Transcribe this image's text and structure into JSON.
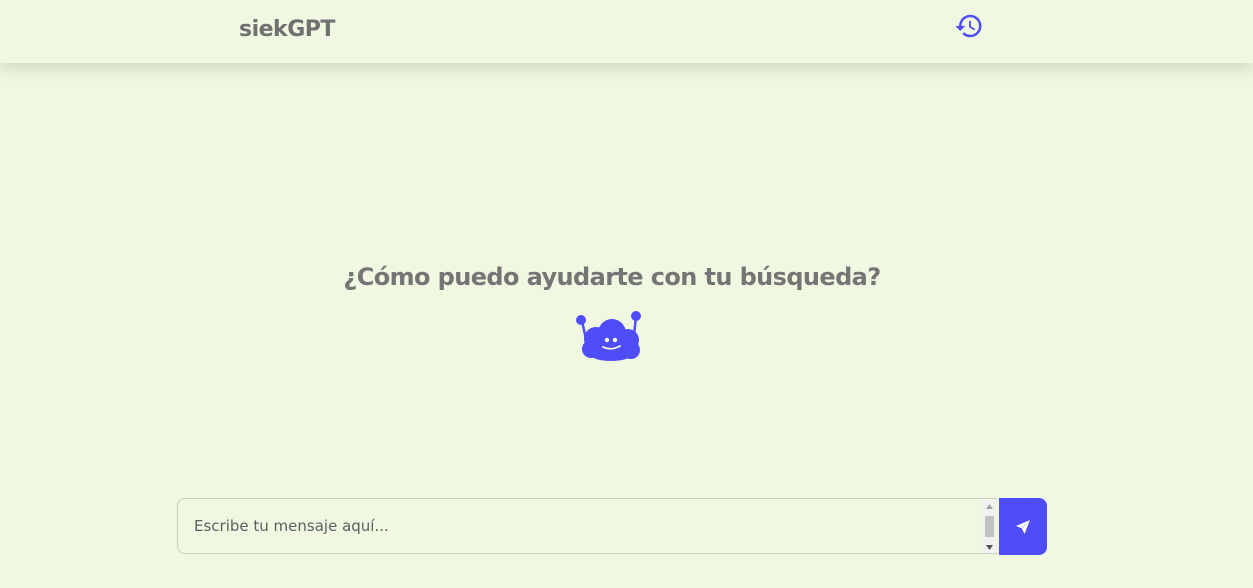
{
  "header": {
    "brand": "siekGPT",
    "history_icon": "history-icon"
  },
  "main": {
    "headline": "¿Cómo puedo ayudarte con tu búsqueda?",
    "mascot_icon": "robot-cloud-icon"
  },
  "composer": {
    "placeholder": "Escribe tu mensaje aquí...",
    "value": "",
    "send_icon": "send-icon"
  },
  "colors": {
    "background": "#f0f8e2",
    "accent": "#4f4df7",
    "text_muted": "#757575"
  }
}
